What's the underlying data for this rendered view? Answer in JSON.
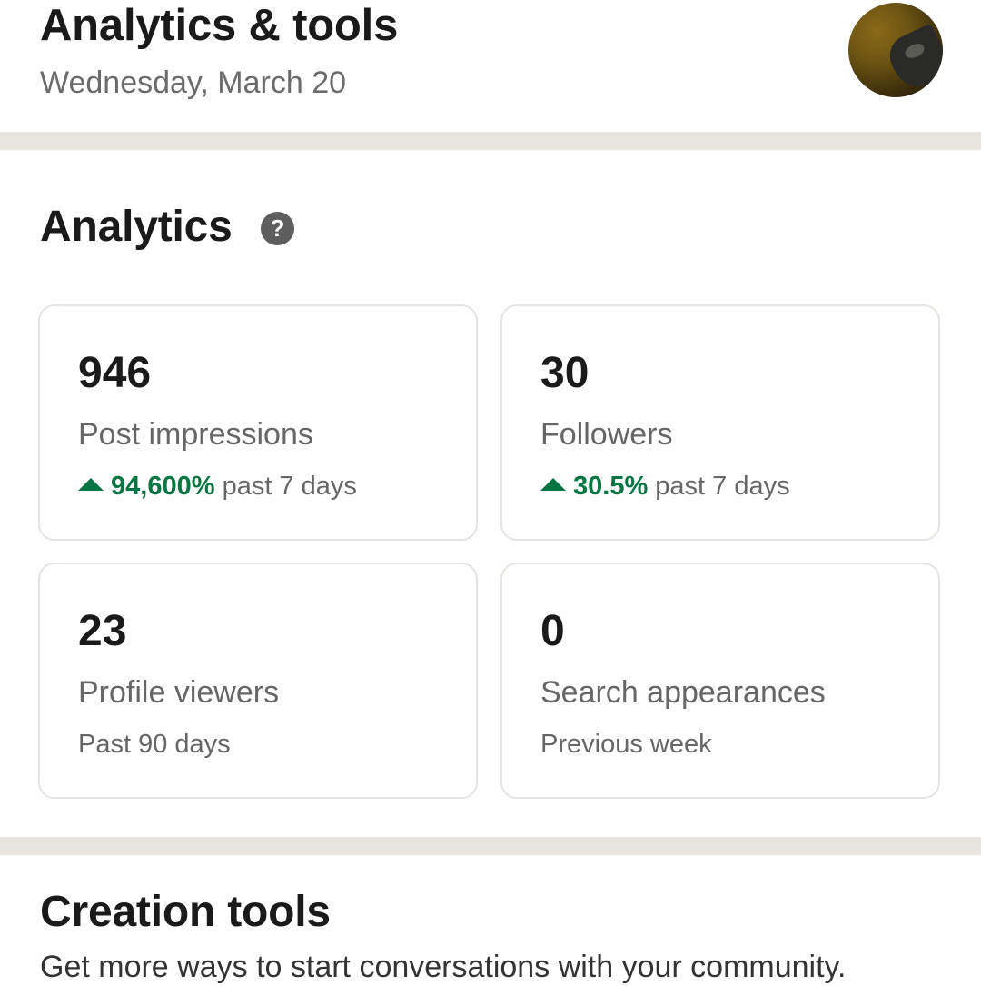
{
  "header": {
    "title": "Analytics & tools",
    "date": "Wednesday, March 20"
  },
  "analytics": {
    "title": "Analytics",
    "help_icon": "question-circle-icon",
    "cards": [
      {
        "value": "946",
        "label": "Post impressions",
        "trend": "94,600%",
        "period": "past 7 days"
      },
      {
        "value": "30",
        "label": "Followers",
        "trend": "30.5%",
        "period": "past 7 days"
      },
      {
        "value": "23",
        "label": "Profile viewers",
        "period": "Past 90 days"
      },
      {
        "value": "0",
        "label": "Search appearances",
        "period": "Previous week"
      }
    ]
  },
  "creation_tools": {
    "title": "Creation tools",
    "description": "Get more ways to start conversations with your community."
  },
  "colors": {
    "trend_green": "#057642",
    "divider": "#e8e5df",
    "card_border": "#e6e4e0",
    "help_icon_bg": "#5e5e5e"
  }
}
